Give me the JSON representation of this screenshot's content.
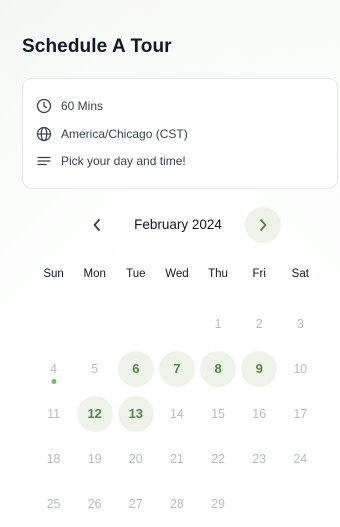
{
  "title": "Schedule A Tour",
  "info": {
    "duration": "60 Mins",
    "timezone": "America/Chicago (CST)",
    "instruction": "Pick your day and time!"
  },
  "calendar": {
    "month_label": "February 2024",
    "weekdays": [
      "Sun",
      "Mon",
      "Tue",
      "Wed",
      "Thu",
      "Fri",
      "Sat"
    ],
    "leading_blanks": 4,
    "days": [
      {
        "n": "1",
        "state": "disabled"
      },
      {
        "n": "2",
        "state": "disabled"
      },
      {
        "n": "3",
        "state": "disabled"
      },
      {
        "n": "4",
        "state": "today"
      },
      {
        "n": "5",
        "state": "disabled"
      },
      {
        "n": "6",
        "state": "available"
      },
      {
        "n": "7",
        "state": "available"
      },
      {
        "n": "8",
        "state": "available"
      },
      {
        "n": "9",
        "state": "available"
      },
      {
        "n": "10",
        "state": "disabled"
      },
      {
        "n": "11",
        "state": "disabled"
      },
      {
        "n": "12",
        "state": "available"
      },
      {
        "n": "13",
        "state": "available"
      },
      {
        "n": "14",
        "state": "disabled"
      },
      {
        "n": "15",
        "state": "disabled"
      },
      {
        "n": "16",
        "state": "disabled"
      },
      {
        "n": "17",
        "state": "disabled"
      },
      {
        "n": "18",
        "state": "disabled"
      },
      {
        "n": "19",
        "state": "disabled"
      },
      {
        "n": "20",
        "state": "disabled"
      },
      {
        "n": "21",
        "state": "disabled"
      },
      {
        "n": "22",
        "state": "disabled"
      },
      {
        "n": "23",
        "state": "disabled"
      },
      {
        "n": "24",
        "state": "disabled"
      },
      {
        "n": "25",
        "state": "disabled"
      },
      {
        "n": "26",
        "state": "disabled"
      },
      {
        "n": "27",
        "state": "disabled"
      },
      {
        "n": "28",
        "state": "disabled"
      },
      {
        "n": "29",
        "state": "disabled"
      }
    ]
  },
  "colors": {
    "accent": "#4e8a3e",
    "accent_bg": "#eef3ea",
    "today_dot": "#7ab56a",
    "muted": "#b8bcc2"
  }
}
